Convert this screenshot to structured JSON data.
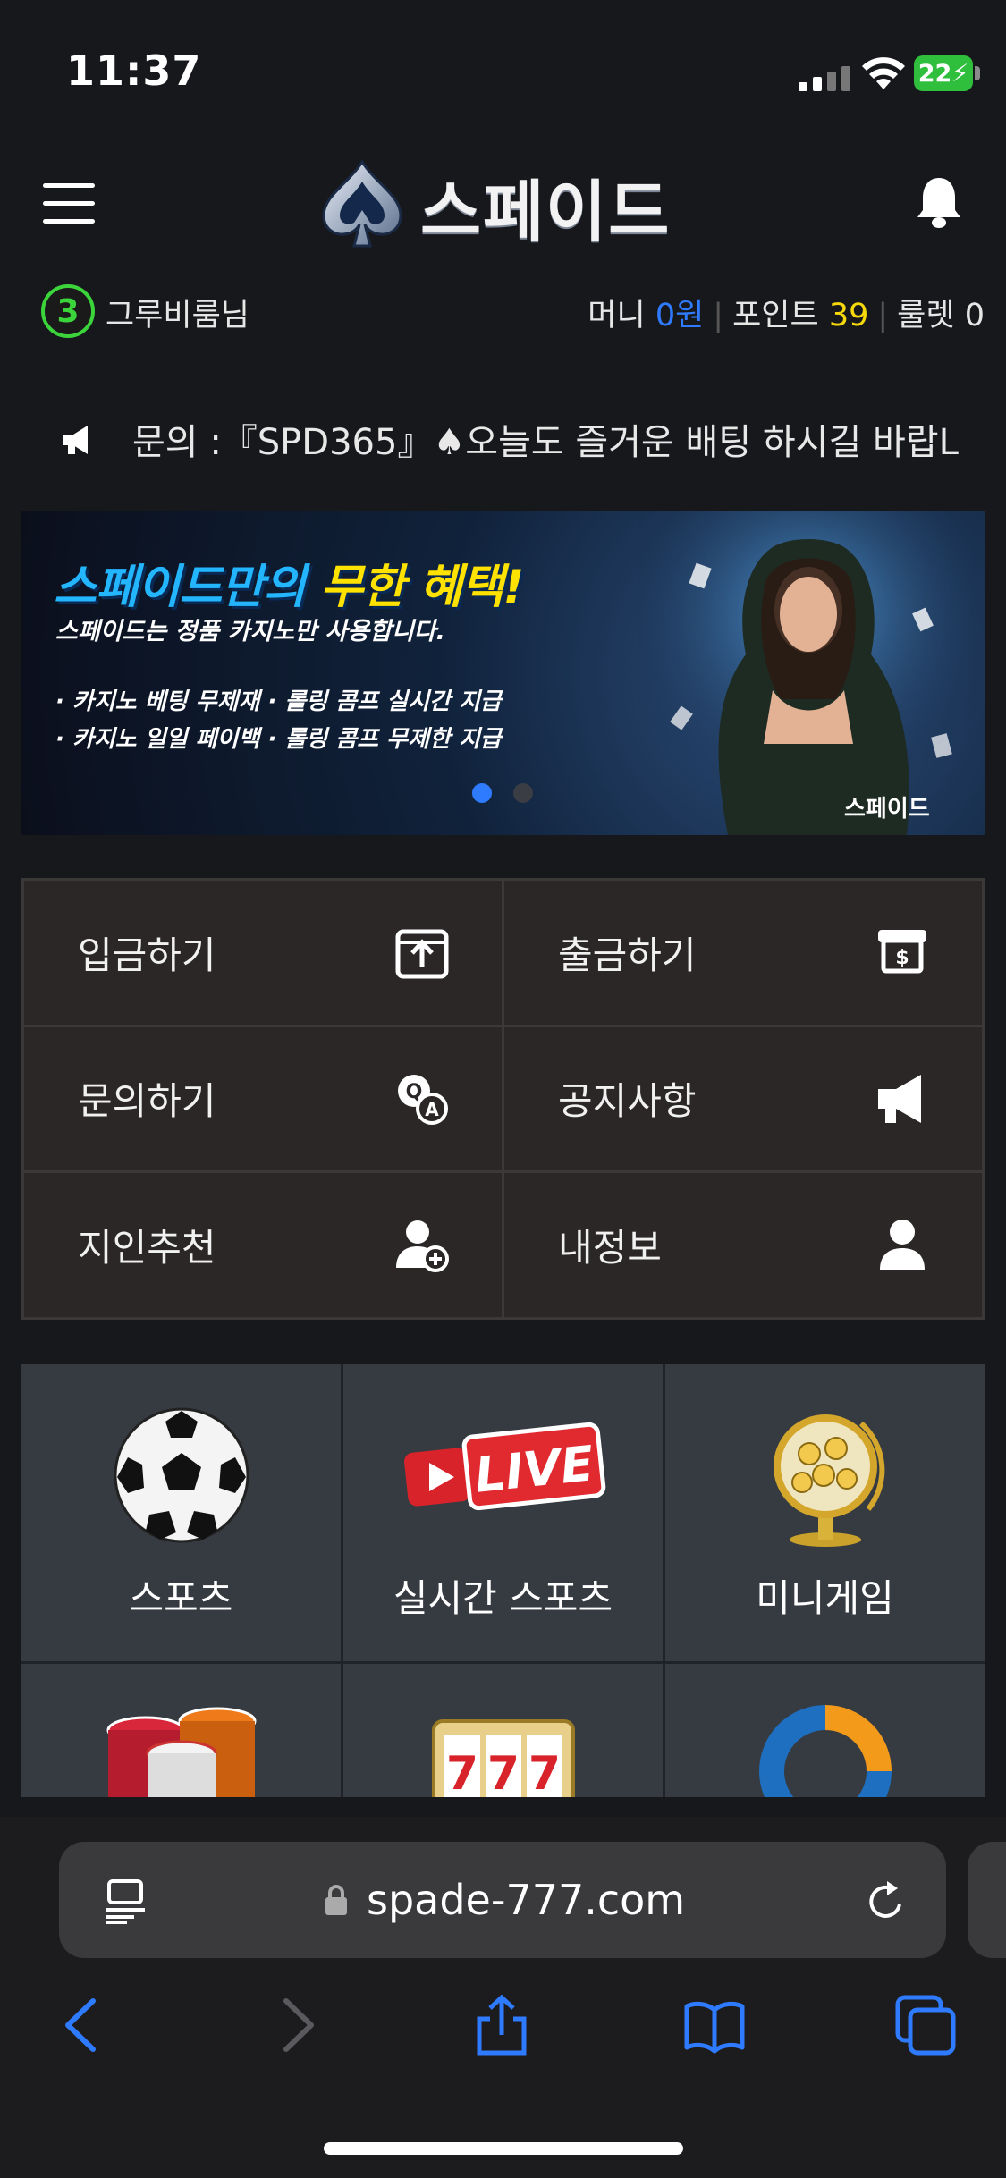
{
  "status_bar": {
    "time": "11:37",
    "battery": "22"
  },
  "header": {
    "logo_text": "스페이드"
  },
  "user": {
    "level": "3",
    "username": "그루비룸님",
    "money_label": "머니",
    "money_value": "0원",
    "point_label": "포인트",
    "point_value": "39",
    "roulette_label": "룰렛",
    "roulette_value": "0"
  },
  "notice": {
    "text": "문의 :『SPD365』♠오늘도 즐거운 배팅 하시길 바랍L"
  },
  "banner": {
    "title_part1": "스페이드만의",
    "title_part2": "무한 혜택!",
    "subtitle": "스페이드는 정품 카지노만 사용합니다.",
    "bullets": [
      "· 카지노 베팅 무제재  · 롤링 콤프 실시간 지급",
      "· 카지노 일일 페이백  · 롤링 콤프 무제한 지급"
    ],
    "logo": "스페이드",
    "active_slide": 1,
    "slide_count": 2
  },
  "quick_menu": [
    {
      "label": "입금하기",
      "icon": "deposit-icon"
    },
    {
      "label": "출금하기",
      "icon": "withdraw-icon"
    },
    {
      "label": "문의하기",
      "icon": "qa-icon"
    },
    {
      "label": "공지사항",
      "icon": "megaphone-icon"
    },
    {
      "label": "지인추천",
      "icon": "add-user-icon"
    },
    {
      "label": "내정보",
      "icon": "user-icon"
    }
  ],
  "games": [
    {
      "label": "스포츠",
      "icon": "soccer-ball-icon"
    },
    {
      "label": "실시간 스포츠",
      "icon": "live-icon"
    },
    {
      "label": "미니게임",
      "icon": "lottery-globe-icon"
    },
    {
      "label": "",
      "icon": "casino-chips-icon"
    },
    {
      "label": "",
      "icon": "slot-machine-icon"
    },
    {
      "label": "",
      "icon": "ring-logo-icon"
    }
  ],
  "live_badge": "LIVE",
  "browser": {
    "url": "spade-777.com"
  }
}
